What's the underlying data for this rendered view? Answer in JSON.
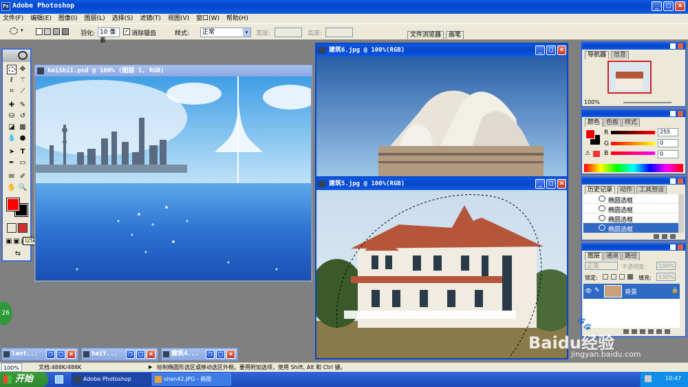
{
  "app": {
    "title": "Adobe Photoshop"
  },
  "menu": [
    "文件(F)",
    "编辑(E)",
    "图像(I)",
    "图层(L)",
    "选择(S)",
    "滤镜(T)",
    "视图(V)",
    "窗口(W)",
    "帮助(H)"
  ],
  "options": {
    "feather_label": "羽化:",
    "feather_value": "10 像素",
    "antialias_label": "消除锯齿",
    "style_label": "样式:",
    "style_value": "正常",
    "width_label": "宽度:",
    "height_label": "高度:",
    "palette_tab1": "文件浏览器",
    "palette_tab2": "画笔"
  },
  "tools_tooltip": "以快速蒙版模式编辑(Q)",
  "docs": {
    "hai": {
      "title": "haiShi1.psd @ 100% (图层 1, RGB)"
    },
    "jz6": {
      "title": "建筑6.jpg @ 100%(RGB)"
    },
    "jz5": {
      "title": "建筑5.jpg @ 100%(RGB)"
    }
  },
  "minimized": [
    {
      "label": "lant..."
    },
    {
      "label": "haiY..."
    },
    {
      "label": "建筑4..."
    }
  ],
  "navigator": {
    "tab1": "导航器",
    "tab2": "信息",
    "zoom": "100%"
  },
  "color": {
    "tab1": "颜色",
    "tab2": "色板",
    "tab3": "样式",
    "r_label": "R",
    "g_label": "G",
    "b_label": "B",
    "r": "255",
    "g": "0",
    "b": "0",
    "fg": "#ff0000",
    "bg": "#000000"
  },
  "history": {
    "tab1": "历史记录",
    "tab2": "动作",
    "tab3": "工具预设",
    "items": [
      "椭圆选框",
      "椭圆选框",
      "椭圆选框",
      "椭圆选框"
    ]
  },
  "layers": {
    "tab1": "图层",
    "tab2": "通道",
    "tab3": "路径",
    "blend": "正常",
    "opacity_label": "不透明度:",
    "opacity": "100%",
    "lock_label": "锁定:",
    "fill_label": "填充:",
    "fill": "100%",
    "layer_name": "背景"
  },
  "status": {
    "zoom": "100%",
    "doc": "文档:488K/488K",
    "hint": "绘制椭圆形选区或移动选区外框。要用附加选项，使用 Shift, Alt 和 Ctrl 键。"
  },
  "taskbar": {
    "start": "开始",
    "items": [
      "Adobe Photoshop",
      "shen42.JPG - 画图"
    ],
    "time": "10:47"
  },
  "badge": "26",
  "watermark": {
    "brand": "Baidu经验",
    "url": "jingyan.baidu.com"
  }
}
